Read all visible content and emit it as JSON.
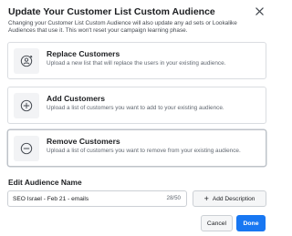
{
  "dialog": {
    "title": "Update Your Customer List Custom Audience",
    "subtitle": "Changing your Customer List Custom Audience will also update any ad sets or Lookalike Audiences that use it. This won't reset your campaign learning phase."
  },
  "options": [
    {
      "title": "Replace Customers",
      "description": "Upload a new list that will replace the users in your existing audience.",
      "icon": "replace-user-icon"
    },
    {
      "title": "Add Customers",
      "description": "Upload a list of customers you want to add to your existing audience.",
      "icon": "plus-circle-icon"
    },
    {
      "title": "Remove Customers",
      "description": "Upload a list of customers you want to remove from your existing audience.",
      "icon": "minus-circle-icon"
    }
  ],
  "audience_name": {
    "label": "Edit Audience Name",
    "value": "SEO Israel - Feb 21 - emails",
    "counter": "28/50"
  },
  "buttons": {
    "add_description": "Add Description",
    "cancel": "Cancel",
    "done": "Done"
  },
  "colors": {
    "primary": "#1877f2",
    "border": "#dadde1"
  }
}
